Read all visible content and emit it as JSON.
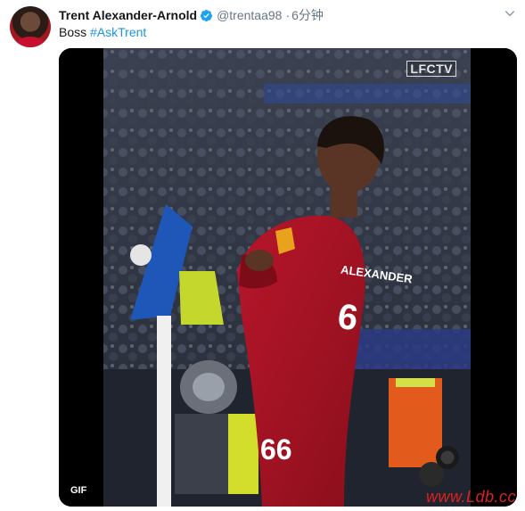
{
  "tweet": {
    "display_name": "Trent Alexander-Arnold",
    "handle": "@trentaa98",
    "separator": "·",
    "time": "6分钟",
    "text_plain": "Boss ",
    "hashtag": "#AskTrent"
  },
  "media": {
    "channel_logo": "LFCTV",
    "badge": "GIF",
    "jersey_name": "ALEXANDER",
    "jersey_number": "66",
    "jersey_number_short": "6"
  },
  "watermark": {
    "text": "www.Ldb.cc"
  },
  "icons": {
    "verified": "verified-badge-icon",
    "caret": "chevron-down-icon"
  },
  "colors": {
    "hashtag": "#1b95e0",
    "verified": "#1da1f2",
    "jersey": "#a8141f",
    "watermark": "#e02020"
  }
}
